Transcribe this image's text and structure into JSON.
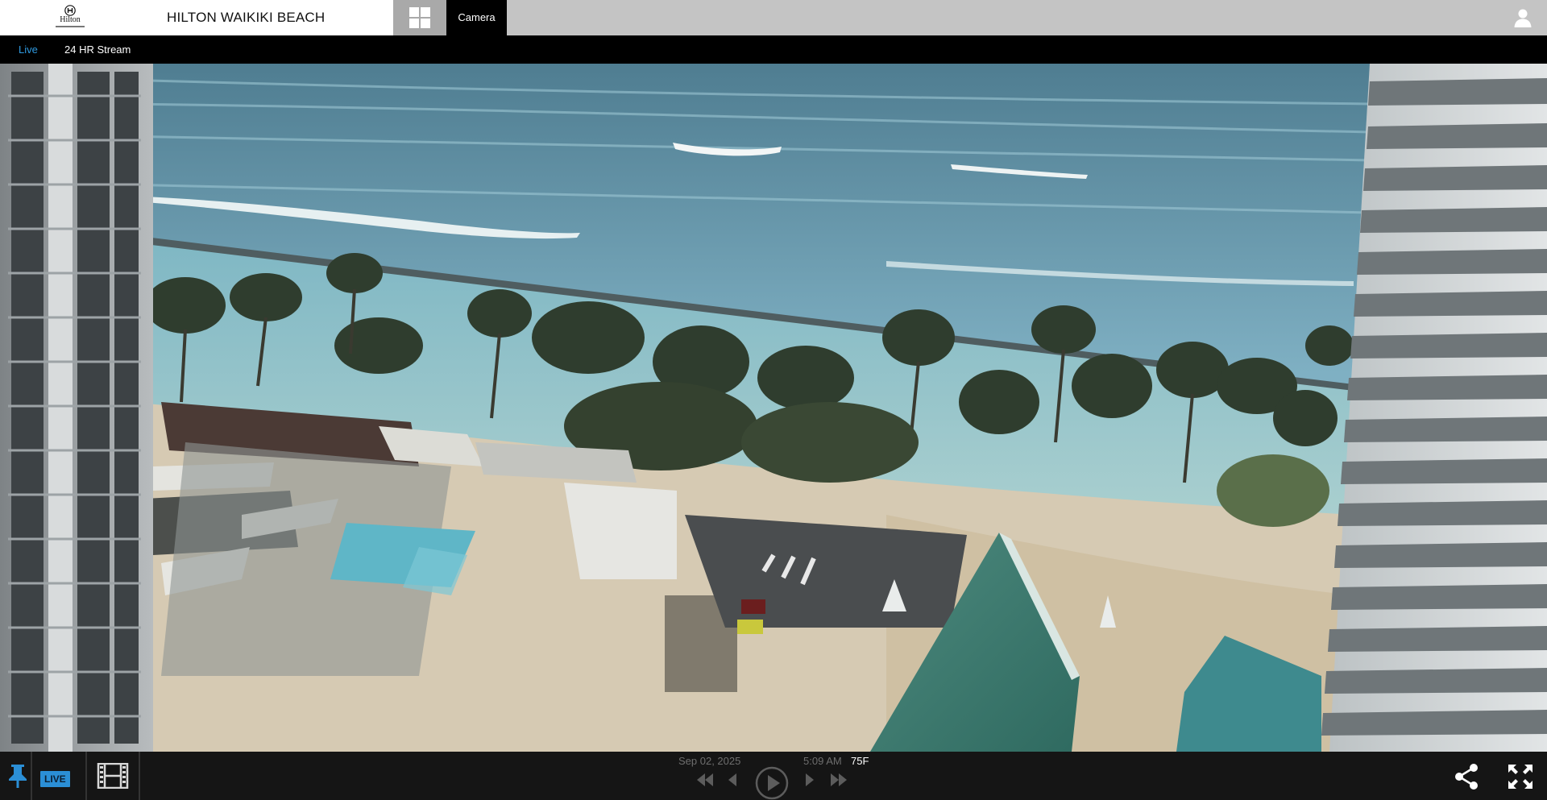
{
  "header": {
    "logo_text": "Hilton",
    "site_title": "HILTON WAIKIKI BEACH",
    "camera_tab_label": "Camera",
    "icons": {
      "grid": "grid-icon",
      "user": "user-icon"
    }
  },
  "subnav": {
    "live_label": "Live",
    "stream_label": "24 HR Stream",
    "active": "Live"
  },
  "player": {
    "scene": "Live webcam view over Waikiki: ocean waves and a breakwater, palm-lined beach, resort pool, street crossing and a green pyramid roof between two high-rise hotel towers",
    "live_badge": "LIVE",
    "date": "Sep 02, 2025",
    "time": "5:09 AM",
    "temperature": "75F",
    "icons": {
      "pin": "pin-icon",
      "film": "film-icon",
      "skip_back": "skip-back-icon",
      "step_back": "step-back-icon",
      "play": "play-icon",
      "step_forward": "step-forward-icon",
      "skip_forward": "skip-forward-icon",
      "share": "share-icon",
      "fullscreen": "fullscreen-icon"
    }
  },
  "colors": {
    "accent": "#2f9ae0",
    "live_badge": "#2b8fd6",
    "topbar": "#c4c4c4",
    "grid_button": "#a9a9a9",
    "control_bar": "#151515"
  }
}
